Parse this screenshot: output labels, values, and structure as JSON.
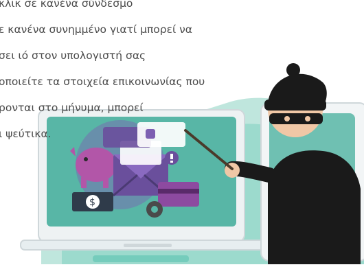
{
  "text_lines": [
    "κλικ σε κανένα σύνδεσμο",
    "ε κανένα συνημμένο γιατί μπορεί να",
    "σει ιό στον υπολογιστή σας",
    "οποιείτε τα στοιχεία επικοινωνίας που",
    "ρονται στο μήνυμα, μπορεί",
    "ι ψεύτικα."
  ],
  "colors": {
    "teal": "#5cc3b0",
    "teal_light": "#bfe6dd",
    "laptop_body": "#eef2f3",
    "laptop_screen": "#58b6a6",
    "phone_body": "#f2f5f6",
    "thief_black": "#1a1a1a",
    "skin": "#f0c7a6",
    "envelope_purple": "#6a4f9c",
    "piggy_pink": "#b256a8",
    "card_purple": "#8d4aa0"
  },
  "icons": [
    "piggy-bank-icon",
    "envelope-icon",
    "credit-card-icon",
    "money-icon",
    "gear-icon",
    "warning-icon",
    "thief-icon"
  ]
}
